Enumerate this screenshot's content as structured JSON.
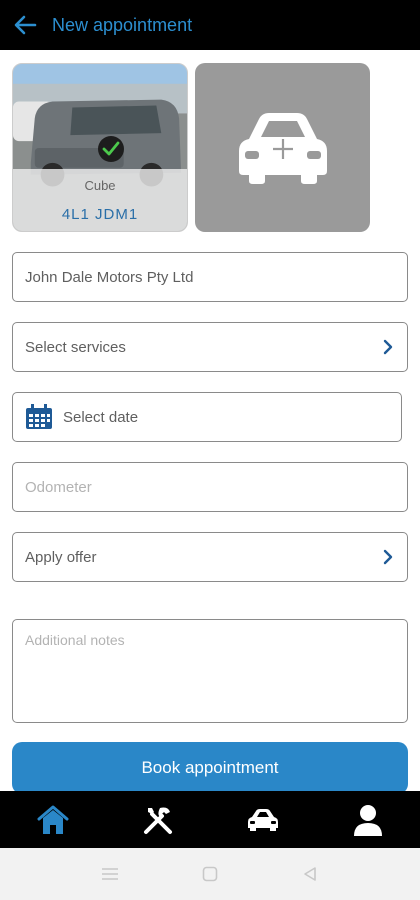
{
  "header": {
    "title": "New appointment"
  },
  "vehicle": {
    "model": "Cube",
    "plate": "4L1 JDM1",
    "selected": true
  },
  "add_vehicle": {
    "icon": "car-add-icon"
  },
  "form": {
    "workshop_value": "John Dale Motors Pty Ltd",
    "services_label": "Select services",
    "date_label": "Select date",
    "odometer_placeholder": "Odometer",
    "offer_label": "Apply offer",
    "notes_placeholder": "Additional notes"
  },
  "actions": {
    "book_label": "Book appointment"
  },
  "bottom_nav": {
    "items": [
      {
        "icon": "home-icon",
        "active": true
      },
      {
        "icon": "tools-icon",
        "active": false
      },
      {
        "icon": "car-icon",
        "active": false
      },
      {
        "icon": "profile-icon",
        "active": false
      }
    ]
  },
  "colors": {
    "accent": "#2a87c8",
    "title": "#2c8fd0",
    "bar": "#000000"
  }
}
